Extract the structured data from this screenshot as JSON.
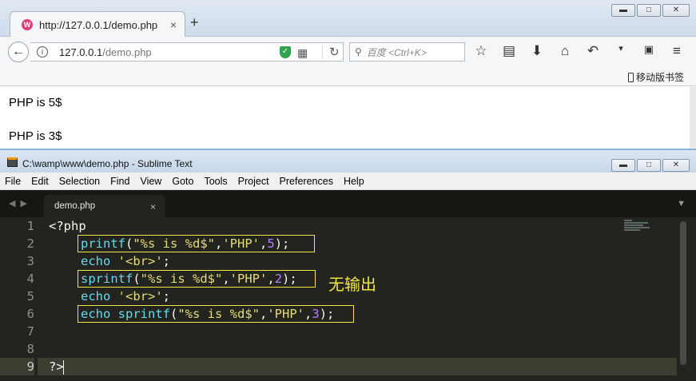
{
  "browser": {
    "tab": {
      "title": "http://127.0.0.1/demo.php",
      "favicon": "W",
      "close": "×"
    },
    "new_tab": "+",
    "window_controls": {
      "minimize": "▬",
      "maximize": "□",
      "close": "✕"
    },
    "back": "←",
    "url_host": "127.0.0.1",
    "url_path": "/demo.php",
    "search_placeholder": "百度 <Ctrl+K>",
    "toolbar_icons": [
      "star-icon",
      "reading-list-icon",
      "download-icon",
      "home-icon",
      "undo-icon",
      "menu-arrow-icon",
      "reader-icon",
      "hamburger-menu-icon"
    ],
    "mobile_bookmarks": "移动版书签",
    "page_output": [
      "PHP is 5$",
      "PHP is 3$"
    ]
  },
  "sublime": {
    "title": "C:\\wamp\\www\\demo.php - Sublime Text",
    "menu": [
      "File",
      "Edit",
      "Selection",
      "Find",
      "View",
      "Goto",
      "Tools",
      "Project",
      "Preferences",
      "Help"
    ],
    "tab_name": "demo.php",
    "tab_close": "×",
    "line_numbers": [
      "1",
      "2",
      "3",
      "4",
      "5",
      "6",
      "7",
      "8",
      "9"
    ],
    "code": {
      "l1": "<?php",
      "l2_fn": "printf",
      "l2_p1": "(",
      "l2_str1": "\"%s is %d$\"",
      "l2_p2": ",",
      "l2_str2": "'PHP'",
      "l2_p3": ",",
      "l2_num": "5",
      "l2_p4": ");",
      "l3_fn": "echo",
      "l3_sp": " ",
      "l3_str": "'<br>'",
      "l3_end": ";",
      "l4_fn": "sprintf",
      "l4_p1": "(",
      "l4_str1": "\"%s is %d$\"",
      "l4_p2": ",",
      "l4_str2": "'PHP'",
      "l4_p3": ",",
      "l4_num": "2",
      "l4_p4": ");",
      "l5_fn": "echo",
      "l5_sp": " ",
      "l5_str": "'<br>'",
      "l5_end": ";",
      "l6_fn": "echo sprintf",
      "l6_p1": "(",
      "l6_str1": "\"%s is %d$\"",
      "l6_p2": ",",
      "l6_str2": "'PHP'",
      "l6_p3": ",",
      "l6_num": "3",
      "l6_p4": ");",
      "l9": "?>"
    },
    "annotation": "无输出"
  }
}
